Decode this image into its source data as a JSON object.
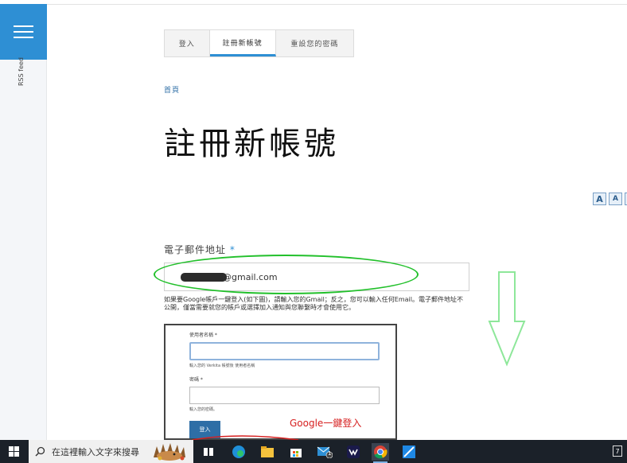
{
  "sidebar": {
    "menu_icon": "hamburger-menu-icon",
    "rss_label": "RSS feed"
  },
  "tabs": [
    {
      "label": "登入"
    },
    {
      "label": "註冊新帳號",
      "active": true
    },
    {
      "label": "重設您的密碼"
    }
  ],
  "breadcrumb": "首頁",
  "page_title": "註冊新帳號",
  "font_size_buttons": [
    {
      "label": "A"
    },
    {
      "label": "A"
    }
  ],
  "email": {
    "label": "電子郵件地址",
    "required_mark": "*",
    "value_suffix": "@gmail.com",
    "help": "如果要Google帳戶一鍵登入(如下圖)，請輸入您的Gmail；反之，您可以輸入任何Email。電子郵件地址不公開，僅當需要就您的帳戶或選擇加入通知與您聯繫時才會使用它。"
  },
  "login_screenshot": {
    "username_label": "使用者名稱 *",
    "username_help": "輸入您的 Verkita 帳號後 使用者名稱",
    "password_label": "密碼 *",
    "password_help": "輸入您的密碼。",
    "login_button": "登入"
  },
  "annotation": {
    "google_note": "Google一鍵登入",
    "ellipse_color": "#22c02b",
    "arrow_color": "#8ee79a"
  },
  "taskbar": {
    "start_icon": "windows-start-icon",
    "search_placeholder": "在這裡輸入文字來搜尋",
    "icons": [
      "task-view-icon",
      "edge-icon",
      "file-explorer-icon",
      "store-icon",
      "mail-icon",
      "webex-icon",
      "chrome-icon",
      "app-icon"
    ],
    "mail_badge": "1",
    "corner_label": "7"
  },
  "colors": {
    "accent": "#2e8fd4",
    "link": "#2e6ea6"
  }
}
